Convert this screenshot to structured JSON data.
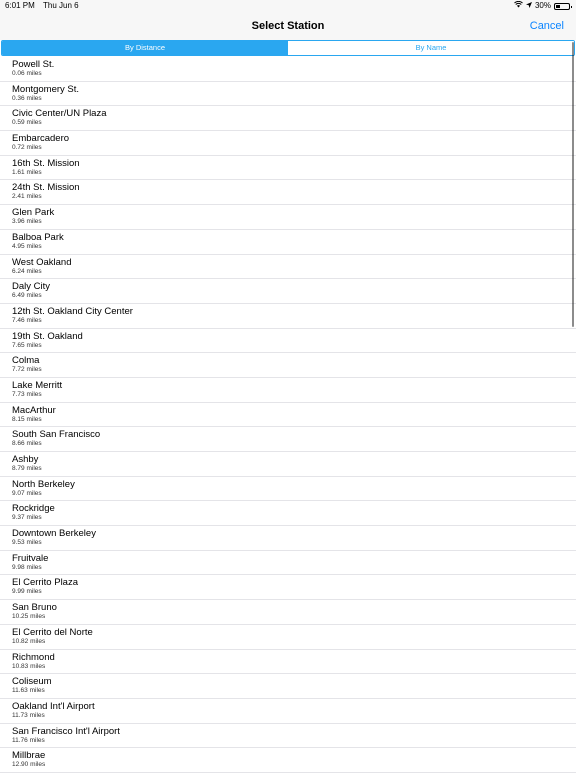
{
  "status_bar": {
    "time": "6:01 PM",
    "date": "Thu Jun 6",
    "battery_text": "30%",
    "battery_level": 0.3,
    "wifi_icon": "wifi-icon",
    "location_icon": "location-arrow-icon"
  },
  "nav": {
    "title": "Select Station",
    "cancel_label": "Cancel"
  },
  "segments": {
    "by_distance": "By Distance",
    "by_name": "By Name",
    "selected": "by_distance"
  },
  "colors": {
    "accent": "#2aa7f0",
    "cancel": "#0a84ff"
  },
  "stations": [
    {
      "name": "Powell St.",
      "distance": "0.06 miles"
    },
    {
      "name": "Montgomery St.",
      "distance": "0.36 miles"
    },
    {
      "name": "Civic Center/UN Plaza",
      "distance": "0.59 miles"
    },
    {
      "name": "Embarcadero",
      "distance": "0.72 miles"
    },
    {
      "name": "16th St. Mission",
      "distance": "1.61 miles"
    },
    {
      "name": "24th St. Mission",
      "distance": "2.41 miles"
    },
    {
      "name": "Glen Park",
      "distance": "3.96 miles"
    },
    {
      "name": "Balboa Park",
      "distance": "4.95 miles"
    },
    {
      "name": "West Oakland",
      "distance": "6.24 miles"
    },
    {
      "name": "Daly City",
      "distance": "6.49 miles"
    },
    {
      "name": "12th St. Oakland City Center",
      "distance": "7.46 miles"
    },
    {
      "name": "19th St. Oakland",
      "distance": "7.65 miles"
    },
    {
      "name": "Colma",
      "distance": "7.72 miles"
    },
    {
      "name": "Lake Merritt",
      "distance": "7.73 miles"
    },
    {
      "name": "MacArthur",
      "distance": "8.15 miles"
    },
    {
      "name": "South San Francisco",
      "distance": "8.66 miles"
    },
    {
      "name": "Ashby",
      "distance": "8.79 miles"
    },
    {
      "name": "North Berkeley",
      "distance": "9.07 miles"
    },
    {
      "name": "Rockridge",
      "distance": "9.37 miles"
    },
    {
      "name": "Downtown Berkeley",
      "distance": "9.53 miles"
    },
    {
      "name": "Fruitvale",
      "distance": "9.98 miles"
    },
    {
      "name": "El Cerrito Plaza",
      "distance": "9.99 miles"
    },
    {
      "name": "San Bruno",
      "distance": "10.25 miles"
    },
    {
      "name": "El Cerrito del Norte",
      "distance": "10.82 miles"
    },
    {
      "name": "Richmond",
      "distance": "10.83 miles"
    },
    {
      "name": "Coliseum",
      "distance": "11.63 miles"
    },
    {
      "name": "Oakland Int'l Airport",
      "distance": "11.73 miles"
    },
    {
      "name": "San Francisco Int'l Airport",
      "distance": "11.76 miles"
    },
    {
      "name": "Millbrae",
      "distance": "12.90 miles"
    }
  ]
}
